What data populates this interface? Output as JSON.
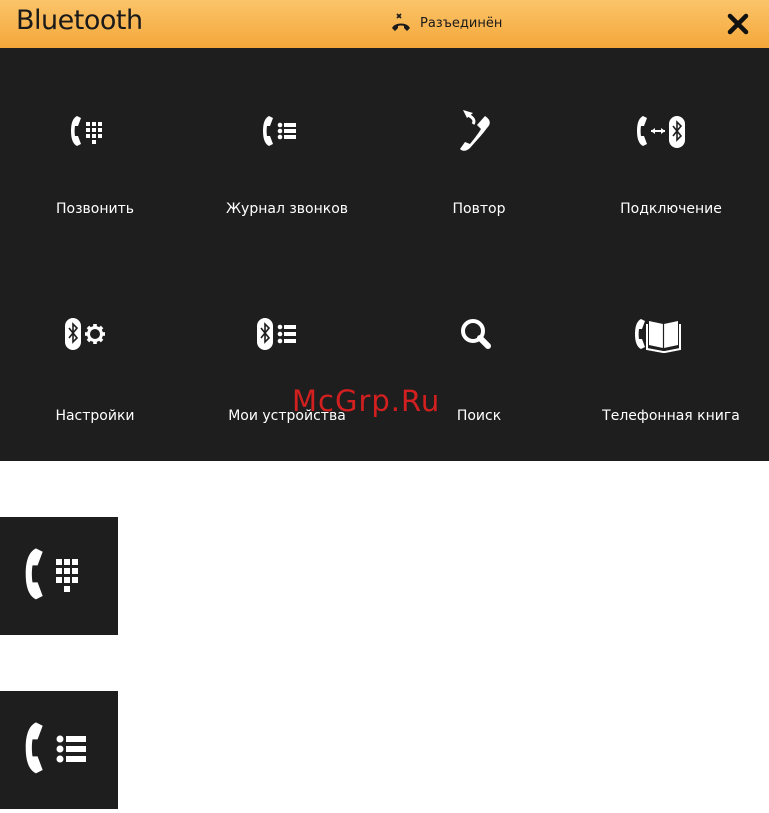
{
  "header": {
    "title": "Bluetooth",
    "status_text": "Разъединён",
    "status_icon": "hangup-icon",
    "close_icon": "close-icon"
  },
  "menu": [
    {
      "label": "Позвонить",
      "icon": "dialpad-phone-icon"
    },
    {
      "label": "Журнал звонков",
      "icon": "call-log-icon"
    },
    {
      "label": "Повтор",
      "icon": "redial-icon"
    },
    {
      "label": "Подключение",
      "icon": "connect-bluetooth-icon"
    },
    {
      "label": "Настройки",
      "icon": "bluetooth-settings-icon"
    },
    {
      "label": "Мои устройства",
      "icon": "my-devices-icon"
    },
    {
      "label": "Поиск",
      "icon": "search-icon"
    },
    {
      "label": "Телефонная книга",
      "icon": "phonebook-icon"
    }
  ],
  "watermark": "McGrp.Ru",
  "colors": {
    "header_top": "#fbc46a",
    "header_bottom": "#f4a73a",
    "background": "#1e1e1e",
    "text": "#ffffff",
    "watermark": "#d21f1f"
  }
}
